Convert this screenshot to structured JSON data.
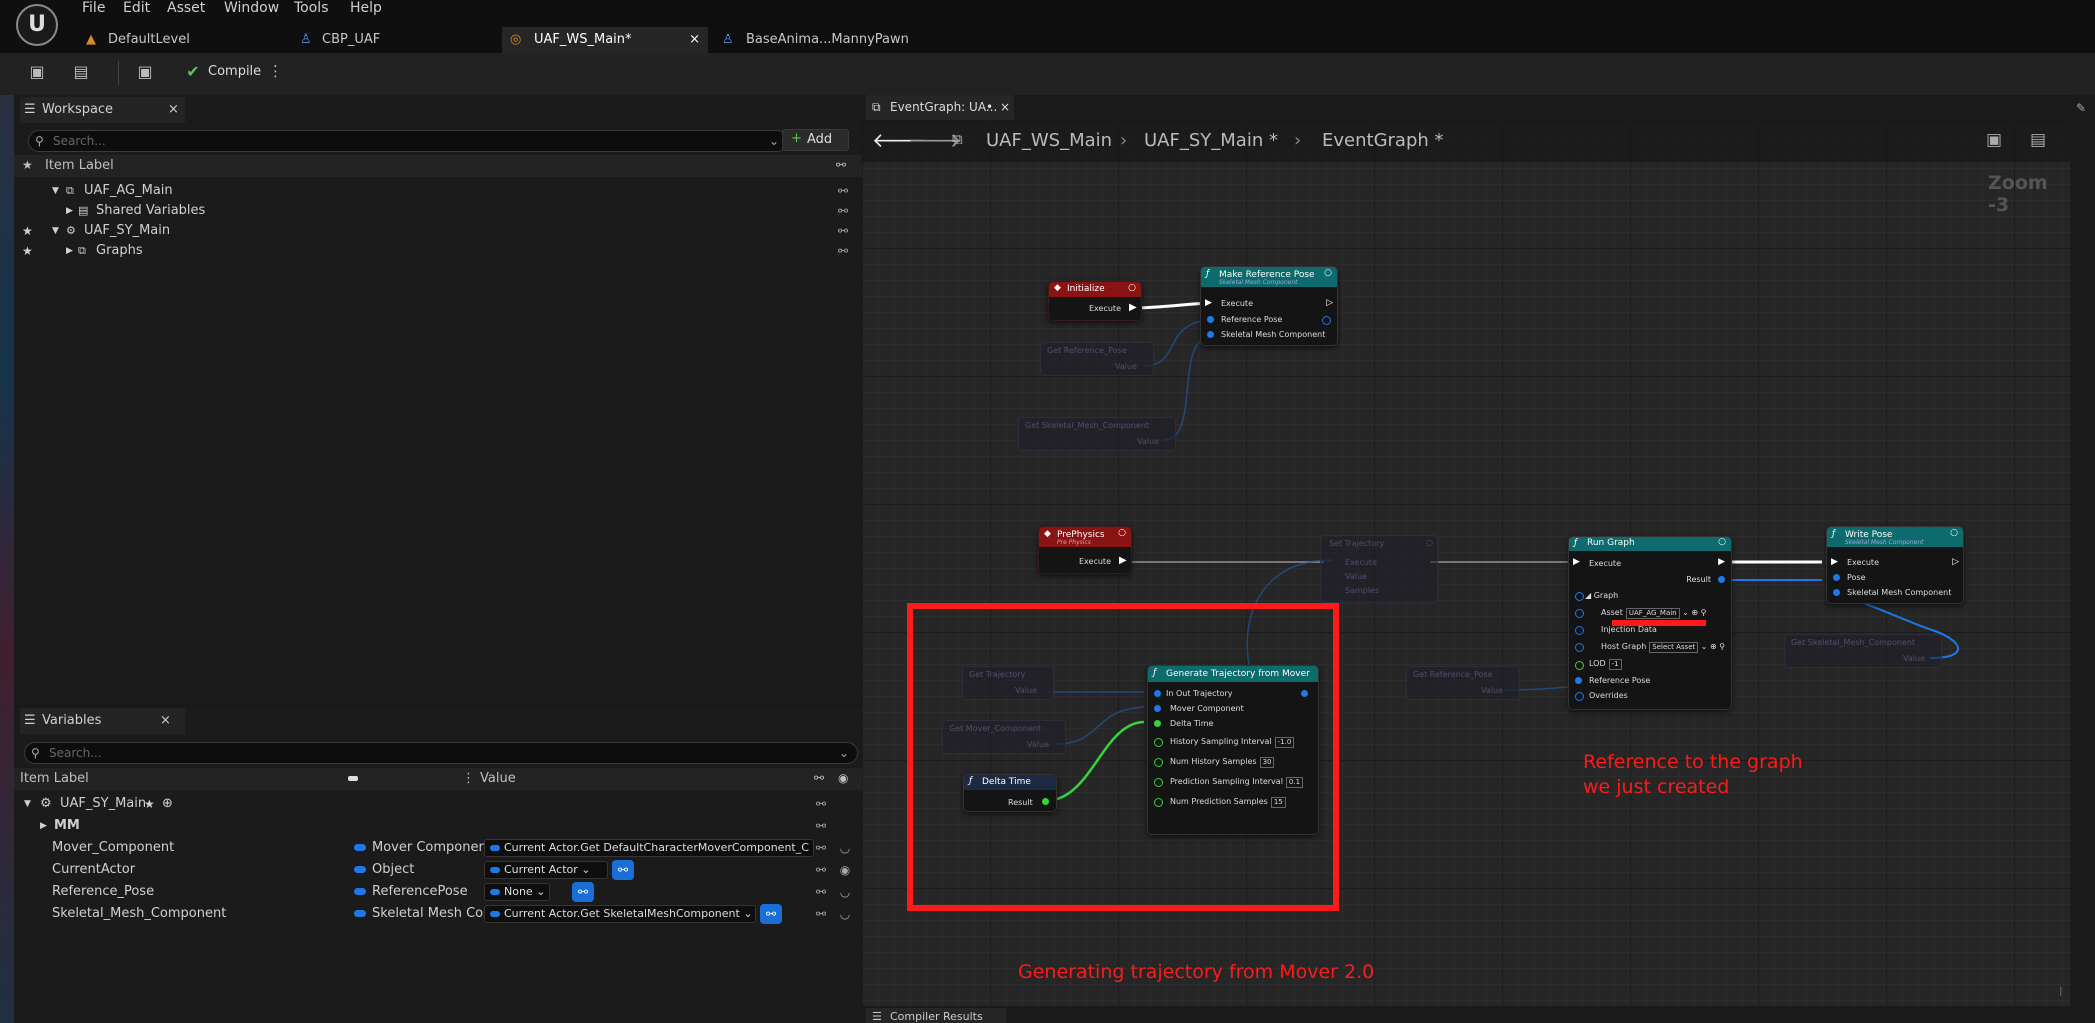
{
  "menu": [
    "File",
    "Edit",
    "Asset",
    "Window",
    "Tools",
    "Help"
  ],
  "tabs": [
    {
      "label": "DefaultLevel"
    },
    {
      "label": "CBP_UAF"
    },
    {
      "label": "UAF_WS_Main*",
      "close": "×"
    },
    {
      "label": "BaseAnima...MannyPawn"
    }
  ],
  "toolbar": {
    "compile_label": "Compile"
  },
  "workspace": {
    "title": "Workspace",
    "search_placeholder": "Search...",
    "add_label": "Add",
    "column_header": "Item Label",
    "items": [
      {
        "label": "UAF_AG_Main"
      },
      {
        "label": "Shared Variables"
      },
      {
        "label": "UAF_SY_Main"
      },
      {
        "label": "Graphs"
      }
    ]
  },
  "variables": {
    "title": "Variables",
    "search_placeholder": "Search...",
    "col_item_label": "Item Label",
    "col_value": "Value",
    "root": "UAF_SY_Main",
    "group": "MM",
    "rows": [
      {
        "name": "Mover_Component",
        "type": "Mover Component",
        "value": "Current Actor.Get DefaultCharacterMoverComponent_C"
      },
      {
        "name": "CurrentActor",
        "type": "Object",
        "value": "Current Actor"
      },
      {
        "name": "Reference_Pose",
        "type": "ReferencePose",
        "value": "None"
      },
      {
        "name": "Skeletal_Mesh_Component",
        "type": "Skeletal Mesh Con",
        "value": "Current Actor.Get SkeletalMeshComponent"
      }
    ]
  },
  "graph_tab": {
    "title": "EventGraph: UA...",
    "dirty": "•"
  },
  "breadcrumb": [
    "UAF_WS_Main",
    "UAF_SY_Main *",
    "EventGraph *"
  ],
  "zoom": "Zoom -3",
  "nodes": {
    "initialize": {
      "title": "Initialize",
      "execute": "Execute"
    },
    "make_ref_pose": {
      "title": "Make Reference Pose",
      "subtitle": "Skeletal Mesh Component",
      "rows": [
        "Execute",
        "Reference Pose",
        "Skeletal Mesh Component"
      ]
    },
    "get_ref_pose_1": {
      "title": "Get Reference_Pose",
      "value": "Value"
    },
    "get_skel_1": {
      "title": "Get Skeletal_Mesh_Component",
      "value": "Value"
    },
    "prephysics": {
      "title": "PrePhysics",
      "subtitle": "Pre Physics",
      "execute": "Execute"
    },
    "set_trajectory": {
      "title": "Set Trajectory",
      "rows": [
        "Execute",
        "Value",
        "Samples"
      ]
    },
    "run_graph": {
      "title": "Run Graph",
      "execute": "Execute",
      "result": "Result",
      "graph": "Graph",
      "asset_label": "Asset",
      "asset_value": "UAF_AG_Main",
      "injection": "Injection Data",
      "host_label": "Host Graph",
      "host_value": "Select Asset",
      "lod_label": "LOD",
      "lod_value": "-1",
      "ref_pose": "Reference Pose",
      "overrides": "Overrides"
    },
    "write_pose": {
      "title": "Write Pose",
      "subtitle": "Skeletal Mesh Component",
      "rows": [
        "Execute",
        "Pose",
        "Skeletal Mesh Component"
      ]
    },
    "get_skel_2": {
      "title": "Get Skeletal_Mesh_Component",
      "value": "Value"
    },
    "get_ref_pose_2": {
      "title": "Get Reference_Pose",
      "value": "Value"
    },
    "get_trajectory": {
      "title": "Get Trajectory",
      "value": "Value"
    },
    "get_mover": {
      "title": "Get Mover_Component",
      "value": "Value"
    },
    "delta_time": {
      "title": "Delta Time",
      "result": "Result"
    },
    "gen_traj": {
      "title": "Generate Trajectory from Mover",
      "rows": [
        {
          "label": "In Out Trajectory"
        },
        {
          "label": "Mover Component"
        },
        {
          "label": "Delta Time"
        },
        {
          "label": "History Sampling Interval",
          "value": "-1.0"
        },
        {
          "label": "Num History Samples",
          "value": "30"
        },
        {
          "label": "Prediction Sampling Interval",
          "value": "0.1"
        },
        {
          "label": "Num Prediction Samples",
          "value": "15"
        }
      ]
    }
  },
  "annotations": {
    "reference": [
      "Reference to the graph",
      "we just created"
    ],
    "generating": "Generating trajectory from Mover 2.0"
  },
  "compiler_results": "Compiler Results",
  "colors": {
    "accent_red": "#ff1a1a",
    "pin_blue": "#1f78e8",
    "pin_green": "#35d43a",
    "event_header": "#8a1313",
    "function_header": "#0e6b6d"
  }
}
